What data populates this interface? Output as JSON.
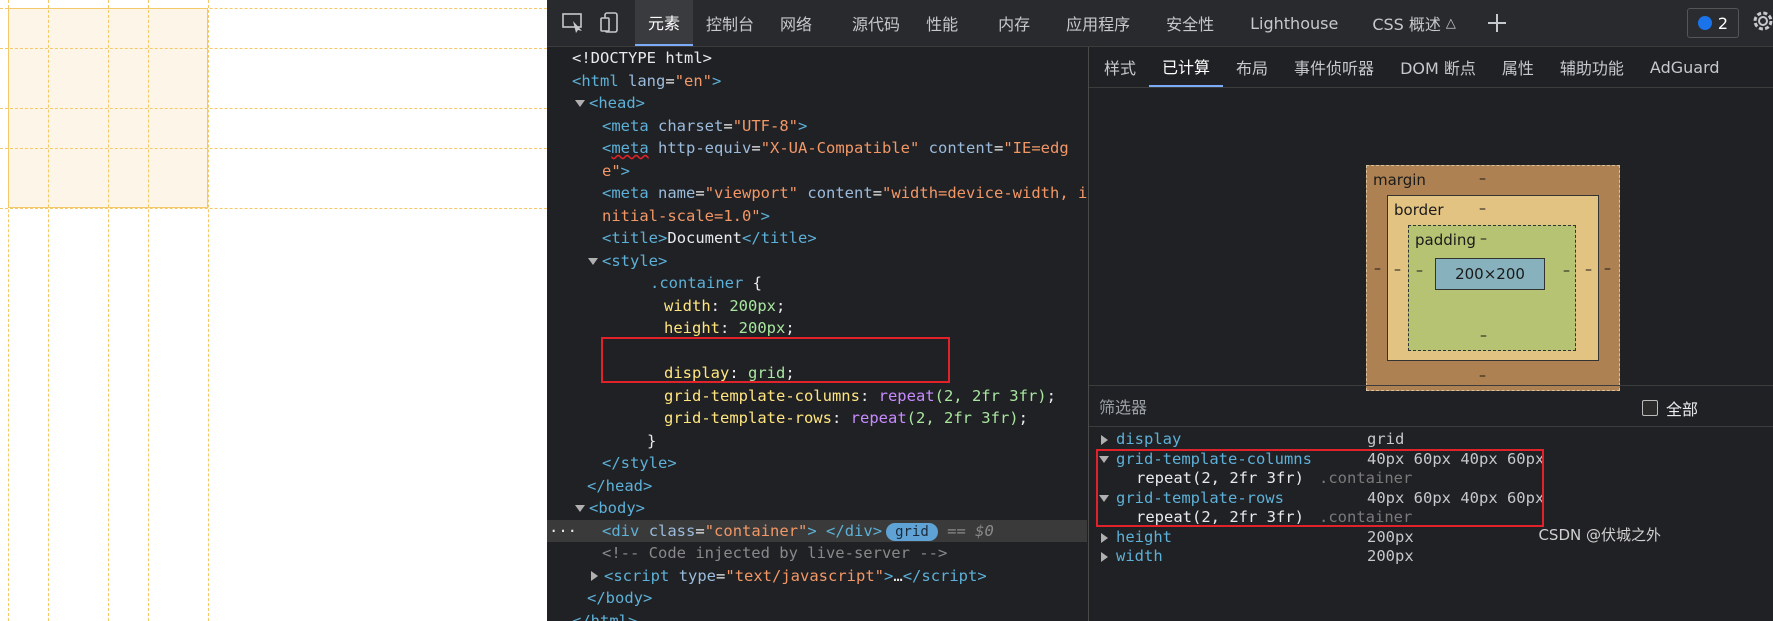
{
  "toolbar": {
    "tabs": [
      "元素",
      "控制台",
      "网络",
      "源代码",
      "性能",
      "内存",
      "应用程序",
      "安全性",
      "Lighthouse",
      "CSS 概述"
    ],
    "active_tab": "元素",
    "issues_count": "2"
  },
  "elements": {
    "doctype": "<!DOCTYPE html>",
    "html_open_tag": "html",
    "html_lang_attr": "lang",
    "html_lang_val": "\"en\"",
    "head": "head",
    "meta_charset": {
      "tag": "meta",
      "attr": "charset",
      "val": "\"UTF-8\""
    },
    "meta_compat": {
      "tag": "meta",
      "attr1": "http-equiv",
      "val1": "\"X-UA-Compatible\"",
      "attr2": "content",
      "val2a": "\"IE=edg",
      "val2b": "e\""
    },
    "meta_viewport": {
      "tag": "meta",
      "attr1": "name",
      "val1": "\"viewport\"",
      "attr2": "content",
      "val2a": "\"width=device-width, i",
      "val2b": "nitial-scale=1.0\""
    },
    "title_tag": "title",
    "title_text": "Document",
    "style_tag": "style",
    "css_selector": ".container",
    "css_rules": [
      {
        "prop": "width",
        "val": "200px"
      },
      {
        "prop": "height",
        "val": "200px"
      },
      {
        "prop": "display",
        "val": "grid"
      },
      {
        "prop": "grid-template-columns",
        "fn": "repeat",
        "args": "(2, 2fr 3fr)"
      },
      {
        "prop": "grid-template-rows",
        "fn": "repeat",
        "args": "(2, 2fr 3fr)"
      }
    ],
    "body_tag": "body",
    "div_tag": "div",
    "div_class_attr": "class",
    "div_class_val": "\"container\"",
    "grid_badge": "grid",
    "eq_dollar": "== $0",
    "comment": "<!-- Code injected by live-server -->",
    "script_tag": "script",
    "script_type_attr": "type",
    "script_type_val": "\"text/javascript\"",
    "ellipsis": "…",
    "html_close": "html",
    "row_dots": "···"
  },
  "subtabs": [
    "样式",
    "已计算",
    "布局",
    "事件侦听器",
    "DOM 断点",
    "属性",
    "辅助功能",
    "AdGuard"
  ],
  "active_subtab": "已计算",
  "box_model": {
    "margin_label": "margin",
    "border_label": "border",
    "padding_label": "padding",
    "content": "200×200",
    "dash": "–"
  },
  "filter": {
    "placeholder": "筛选器",
    "show_all": "全部"
  },
  "computed": [
    {
      "name": "display",
      "value": "grid",
      "expanded": false
    },
    {
      "name": "grid-template-columns",
      "value": "40px 60px 40px 60px",
      "expanded": true,
      "sub": "repeat(2, 2fr 3fr)",
      "src": ".container"
    },
    {
      "name": "grid-template-rows",
      "value": "40px 60px 40px 60px",
      "expanded": true,
      "sub": "repeat(2, 2fr 3fr)",
      "src": ".container"
    },
    {
      "name": "height",
      "value": "200px",
      "expanded": false
    },
    {
      "name": "width",
      "value": "200px",
      "expanded": false
    }
  ],
  "watermark": "CSDN @伏城之外",
  "colors": {
    "highlight_red": "#e0222a",
    "grid_overlay": "#f5c96a",
    "accent": "#7cacf8"
  }
}
